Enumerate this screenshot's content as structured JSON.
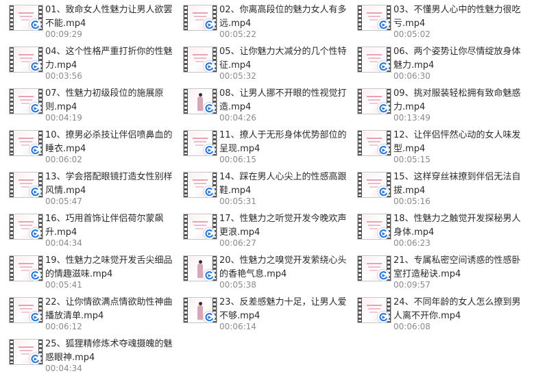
{
  "files": [
    {
      "name": "01、致命女人性魅力让男人欲罢不能.mp4",
      "duration": "00:09:29",
      "person": false
    },
    {
      "name": "02、你离高段位的魅力女人有多远.mp4",
      "duration": "00:05:22",
      "person": false
    },
    {
      "name": "03、不懂男人心中的性魅力很吃亏.mp4",
      "duration": "00:05:02",
      "person": false
    },
    {
      "name": "04、这个性格严重打折你的性魅力.mp4",
      "duration": "00:03:56",
      "person": false
    },
    {
      "name": "05、让你魅力大减分的几个性特征.mp4",
      "duration": "00:05:32",
      "person": false
    },
    {
      "name": "06、两个姿势让你尽情绽放身体魅力.mp4",
      "duration": "00:06:30",
      "person": false
    },
    {
      "name": "07、性魅力初级段位的施展原则.mp4",
      "duration": "00:04:19",
      "person": false
    },
    {
      "name": "08、让男人挪不开眼的性视觉打造.mp4",
      "duration": "00:04:26",
      "person": true
    },
    {
      "name": "09、挑对服装轻松拥有致命魅惑力.mp4",
      "duration": "00:13:49",
      "person": false
    },
    {
      "name": "10、撩男必杀技让伴侣喷鼻血的睡衣.mp4",
      "duration": "00:06:02",
      "person": false
    },
    {
      "name": "11、撩人于无形身体优势部位的呈现.mp4",
      "duration": "00:06:15",
      "person": false
    },
    {
      "name": "12、让伴侣怦然心动的女人味发型.mp4",
      "duration": "00:05:15",
      "person": false
    },
    {
      "name": "13、学会搭配眼镜打造女性别样风情.mp4",
      "duration": "00:05:47",
      "person": false
    },
    {
      "name": "14、踩在男人心尖上的性感高跟鞋.mp4",
      "duration": "00:05:31",
      "person": false
    },
    {
      "name": "15、这样穿丝袜撩到伴侣无法自拔.mp4",
      "duration": "00:05:16",
      "person": false
    },
    {
      "name": "16、巧用首饰让伴侣荷尔蒙飙升.mp4",
      "duration": "00:04:34",
      "person": false
    },
    {
      "name": "17、性魅力之听觉开发今晚欢声更浪.mp4",
      "duration": "00:06:27",
      "person": false
    },
    {
      "name": "18、性魅力之触觉开发探秘男人身体.mp4",
      "duration": "00:06:23",
      "person": false
    },
    {
      "name": "19、性魅力之味觉开发舌尖细品的情趣滋味.mp4",
      "duration": "00:05:41",
      "person": false
    },
    {
      "name": "20、性魅力之嗅觉开发萦绕心头的香艳气息.mp4",
      "duration": "00:05:38",
      "person": true
    },
    {
      "name": "21、专属私密空间诱惑的性感卧室打造秘诀.mp4",
      "duration": "00:09:57",
      "person": false
    },
    {
      "name": "22、让你情欲满点情欲助性神曲播放清单.mp4",
      "duration": "00:06:12",
      "person": false
    },
    {
      "name": "23、反差感魅力十足，让男人爱不够.mp4",
      "duration": "00:06:14",
      "person": true
    },
    {
      "name": "24、不同年龄的女人怎么撩到男人离不开你.mp4",
      "duration": "00:06:08",
      "person": false
    },
    {
      "name": "25、狐狸精修炼术夺魂摄魄的魅惑眼神.mp4",
      "duration": "00:04:34",
      "person": false
    }
  ],
  "colors": {
    "title": "#2b2b2b",
    "duration": "#8a8a8a",
    "accent": "#1a73e8",
    "thumb_bg": "#fdeef1"
  },
  "icons": {
    "file_type": "video-file-icon",
    "overlay": "media-player-badge-icon"
  }
}
